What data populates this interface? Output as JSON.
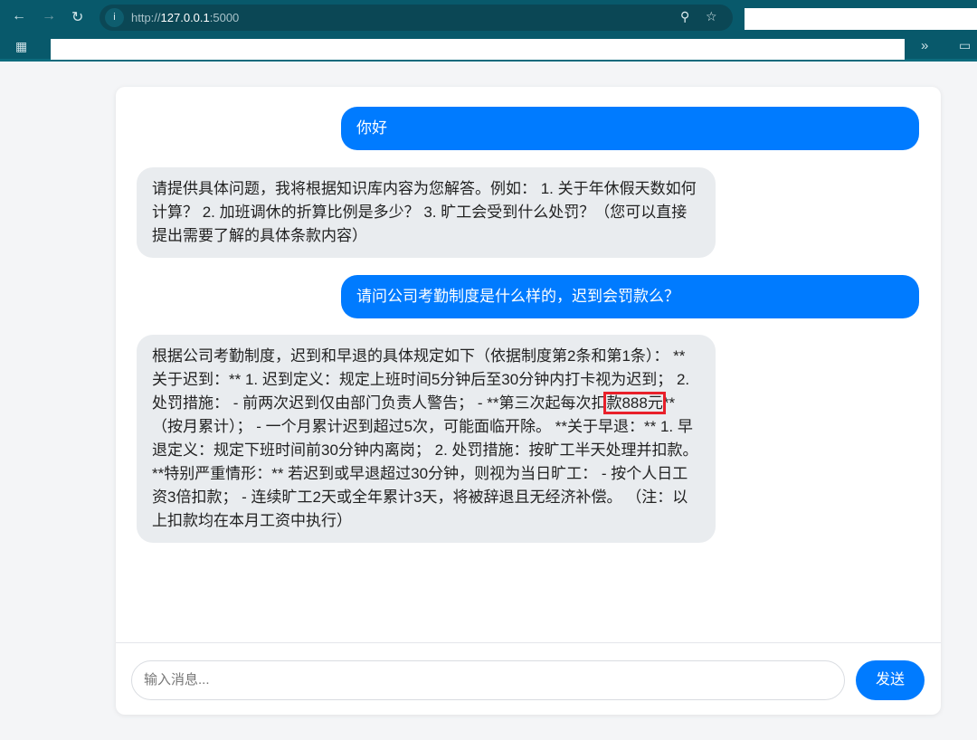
{
  "browser": {
    "url_scheme": "http://",
    "url_host": "127.0.0.1",
    "url_port": ":5000"
  },
  "chat": {
    "messages": [
      {
        "role": "user",
        "text": "你好"
      },
      {
        "role": "assistant",
        "text": "请提供具体问题，我将根据知识库内容为您解答。例如： 1. 关于年休假天数如何计算？ 2. 加班调休的折算比例是多少？ 3. 旷工会受到什么处罚？（您可以直接提出需要了解的具体条款内容）"
      },
      {
        "role": "user",
        "text": "请问公司考勤制度是什么样的，迟到会罚款么？"
      },
      {
        "role": "assistant",
        "text_before": "根据公司考勤制度，迟到和早退的具体规定如下（依据制度第2条和第1条）： **关于迟到：** 1. 迟到定义：规定上班时间5分钟后至30分钟内打卡视为迟到； 2. 处罚措施： - 前两次迟到仅由部门负责人警告； - **第三次起每次扣",
        "text_highlight": "款888元",
        "text_after": "**（按月累计）； - 一个月累计迟到超过5次，可能面临开除。 **关于早退：** 1. 早退定义：规定下班时间前30分钟内离岗； 2. 处罚措施：按旷工半天处理并扣款。 **特别严重情形：** 若迟到或早退超过30分钟，则视为当日旷工： - 按个人日工资3倍扣款； - 连续旷工2天或全年累计3天，将被辞退且无经济补偿。 （注：以上扣款均在本月工资中执行）"
      }
    ],
    "input_placeholder": "输入消息...",
    "send_label": "发送"
  },
  "colors": {
    "accent": "#007bff",
    "bot_bubble": "#e9ecef",
    "browser": "#08596b",
    "highlight": "#e8202a"
  }
}
